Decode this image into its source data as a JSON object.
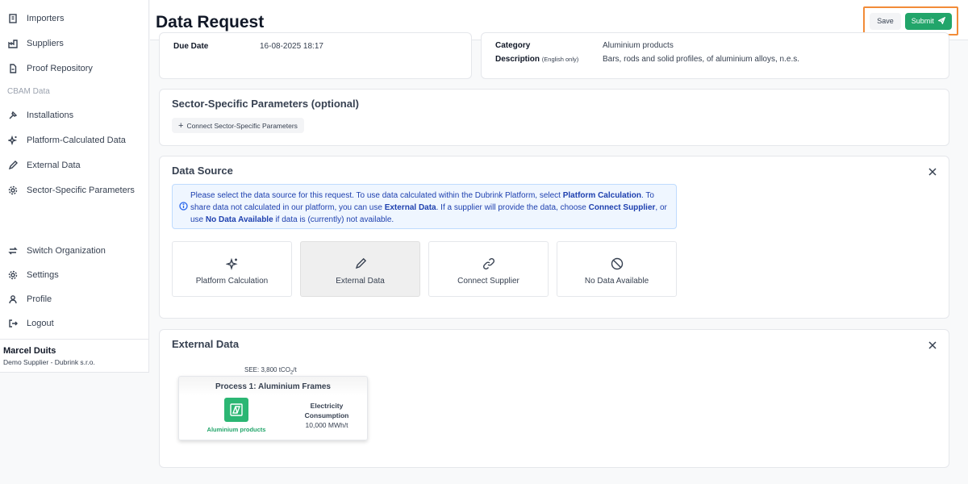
{
  "sidebar": {
    "items_top": [
      {
        "label": "Importers",
        "icon": "building-icon"
      },
      {
        "label": "Suppliers",
        "icon": "factory-icon"
      },
      {
        "label": "Proof Repository",
        "icon": "document-icon"
      }
    ],
    "section_label": "CBAM Data",
    "items_cbam": [
      {
        "label": "Installations",
        "icon": "hammer-icon"
      },
      {
        "label": "Platform-Calculated Data",
        "icon": "sparkle-icon"
      },
      {
        "label": "External Data",
        "icon": "pencil-icon"
      },
      {
        "label": "Sector-Specific Parameters",
        "icon": "gear-icon"
      }
    ],
    "items_bottom": [
      {
        "label": "Switch Organization",
        "icon": "switch-icon"
      },
      {
        "label": "Settings",
        "icon": "gear-icon"
      },
      {
        "label": "Profile",
        "icon": "user-icon"
      },
      {
        "label": "Logout",
        "icon": "logout-icon"
      }
    ],
    "user": {
      "name": "Marcel Duits",
      "org": "Demo Supplier - Dubrink s.r.o."
    }
  },
  "header": {
    "title": "Data Request",
    "save_label": "Save",
    "submit_label": "Submit",
    "highlight_color": "#f28c38"
  },
  "request_info": {
    "due_date_label": "Due Date",
    "due_date_value": "16-08-2025 18:17",
    "category_label": "Category",
    "category_value": "Aluminium products",
    "description_label": "Description",
    "description_note": "(English only)",
    "description_value": "Bars, rods and solid profiles, of aluminium alloys, n.e.s."
  },
  "sector_params": {
    "title": "Sector-Specific Parameters (optional)",
    "button_label": "Connect Sector-Specific Parameters"
  },
  "data_source": {
    "title": "Data Source",
    "info": {
      "t1": "Please select the data source for this request. To use data calculated within the Dubrink Platform, select ",
      "b1": "Platform Calculation",
      "t2": ". To share data not calculated in our platform, you can use ",
      "b2": "External Data",
      "t3": ". If a supplier will provide the data, choose ",
      "b3": "Connect Supplier",
      "t4": ", or use ",
      "b4": "No Data Available",
      "t5": " if data is (currently) not available."
    },
    "options": [
      {
        "label": "Platform Calculation",
        "icon": "sparkle-icon",
        "selected": false
      },
      {
        "label": "External Data",
        "icon": "pencil-icon",
        "selected": true
      },
      {
        "label": "Connect Supplier",
        "icon": "link-icon",
        "selected": false
      },
      {
        "label": "No Data Available",
        "icon": "ban-icon",
        "selected": false
      }
    ]
  },
  "external_data": {
    "title": "External Data",
    "see_prefix": "SEE: 3,800 tCO",
    "see_sub": "2",
    "see_suffix": "/t",
    "process_title": "Process 1: Aluminium Frames",
    "product_label": "Aluminium products",
    "product_icon": "aluminium-icon",
    "product_color": "#2bb673",
    "metric_name": "Electricity Consumption",
    "metric_value": "10,000 MWh/t"
  },
  "colors": {
    "accent_green": "#22a56a",
    "info_blue": "#1e40af"
  }
}
